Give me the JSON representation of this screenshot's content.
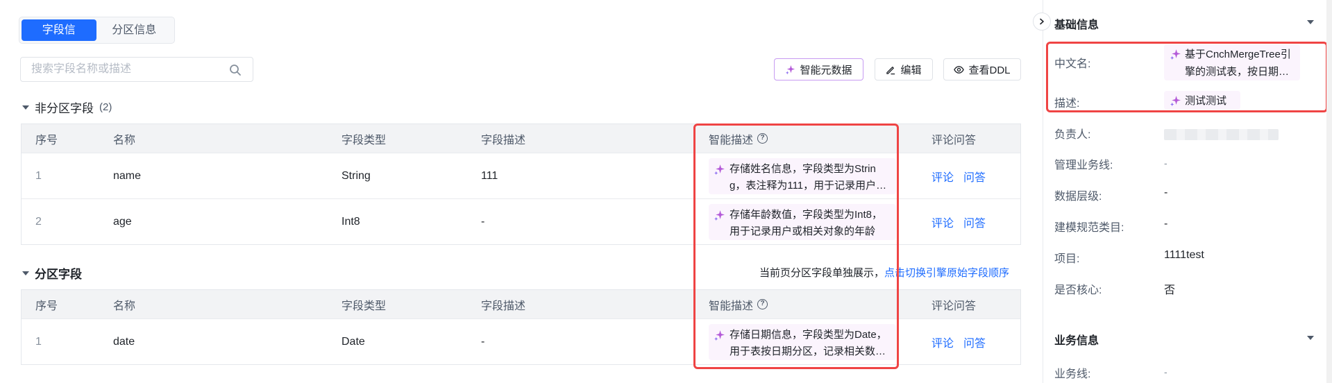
{
  "tabs": [
    {
      "label": "字段信息",
      "active": true
    },
    {
      "label": "分区信息",
      "active": false
    }
  ],
  "search": {
    "placeholder": "搜索字段名称或描述",
    "value": ""
  },
  "toolbar": {
    "ai_label": "智能元数据",
    "edit_label": "编辑",
    "ddl_label": "查看DDL"
  },
  "non_partition": {
    "title": "非分区字段",
    "count": "(2)",
    "headers": {
      "idx": "序号",
      "name": "名称",
      "type": "字段类型",
      "desc": "字段描述",
      "ai": "智能描述",
      "comment": "评论问答"
    },
    "rows": [
      {
        "idx": "1",
        "name": "name",
        "type": "String",
        "desc": "111",
        "ai": "存储姓名信息，字段类型为String，表注释为111，用于记录用户或相关对象的姓名",
        "comment": "评论",
        "qa": "问答"
      },
      {
        "idx": "2",
        "name": "age",
        "type": "Int8",
        "desc": "-",
        "ai": "存储年龄数值，字段类型为Int8，用于记录用户或相关对象的年龄",
        "comment": "评论",
        "qa": "问答"
      }
    ]
  },
  "partition": {
    "title": "分区字段",
    "note": "当前页分区字段单独展示，",
    "note_link": "点击切换引擎原始字段顺序",
    "headers": {
      "idx": "序号",
      "name": "名称",
      "type": "字段类型",
      "desc": "字段描述",
      "ai": "智能描述",
      "comment": "评论问答"
    },
    "rows": [
      {
        "idx": "1",
        "name": "date",
        "type": "Date",
        "desc": "-",
        "ai": "存储日期信息，字段类型为Date，用于表按日期分区，记录相关数据的日期",
        "comment": "评论",
        "qa": "问答"
      }
    ]
  },
  "side": {
    "basic_title": "基础信息",
    "fields": {
      "cn_name_label": "中文名:",
      "cn_name_value": "基于CnchMergeTree引擎的测试表，按日期分区存储",
      "desc_label": "描述:",
      "desc_value": "测试测试",
      "owner_label": "负责人:",
      "biz_line_label": "管理业务线:",
      "biz_line_value": "-",
      "layer_label": "数据层级:",
      "layer_value": "-",
      "model_label": "建模规范类目:",
      "model_value": "-",
      "project_label": "项目:",
      "project_value": "1111test",
      "core_label": "是否核心:",
      "core_value": "否"
    },
    "business_title": "业务信息",
    "business_line_label": "业务线:",
    "business_line_value": "-"
  },
  "colors": {
    "primary": "#1e6cff",
    "ai_bg": "#fbf4fd",
    "highlight": "#ef4444",
    "ai_border": "#c79bf2"
  }
}
